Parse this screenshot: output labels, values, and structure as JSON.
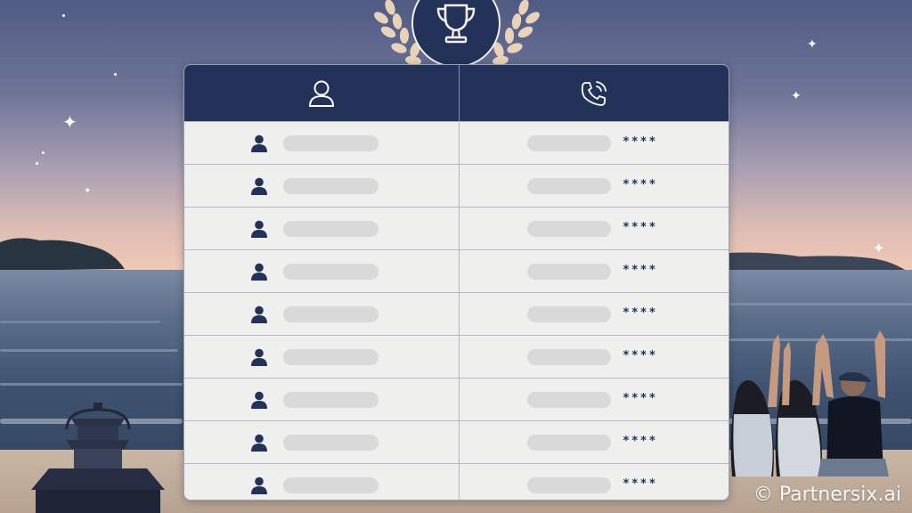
{
  "table": {
    "header_icons": [
      "user-outline-icon",
      "phone-icon"
    ],
    "rows": [
      {
        "icon": "user-filled-icon",
        "masked": "****"
      },
      {
        "icon": "user-filled-icon",
        "masked": "****"
      },
      {
        "icon": "user-filled-icon",
        "masked": "****"
      },
      {
        "icon": "user-filled-icon",
        "masked": "****"
      },
      {
        "icon": "user-filled-icon",
        "masked": "****"
      },
      {
        "icon": "user-filled-icon",
        "masked": "****"
      },
      {
        "icon": "user-filled-icon",
        "masked": "****"
      },
      {
        "icon": "user-filled-icon",
        "masked": "****"
      },
      {
        "icon": "user-filled-icon",
        "masked": "****"
      }
    ]
  },
  "badge": {
    "icon": "trophy-icon"
  },
  "watermark": "© Partnersix.ai",
  "colors": {
    "navy": "#233259",
    "row_bg": "#efefed",
    "placeholder_bar": "#d9d9d9",
    "wreath": "#e9d3b8"
  }
}
